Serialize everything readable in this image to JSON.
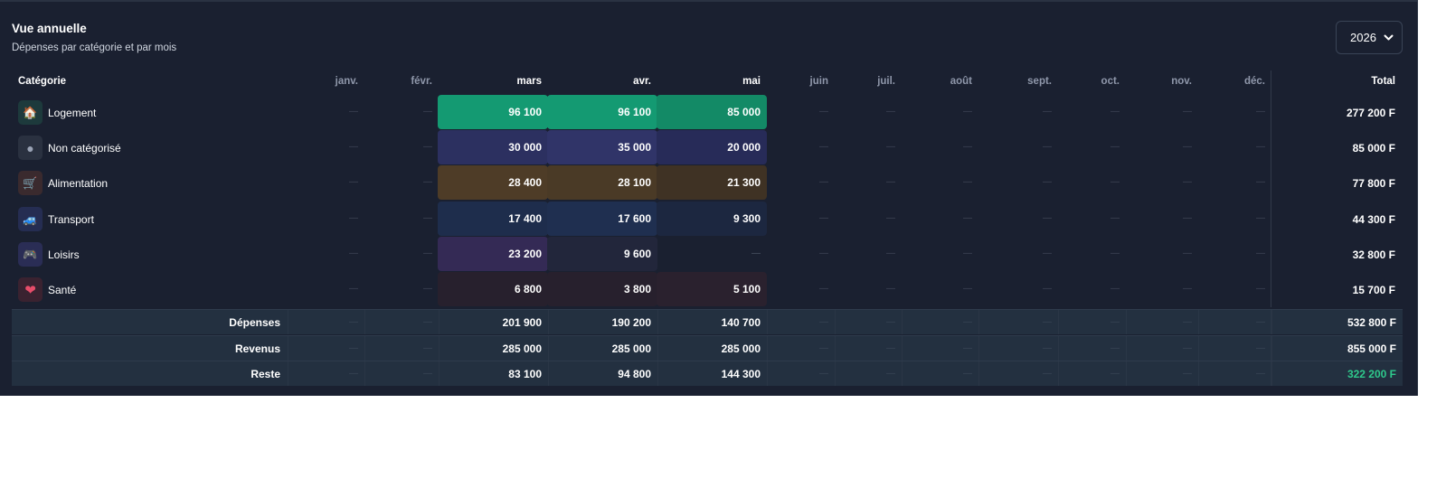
{
  "header": {
    "title": "Vue annuelle",
    "subtitle": "Dépenses par catégorie et par mois",
    "year": "2026"
  },
  "columns": {
    "category": "Catégorie",
    "months": [
      "janv.",
      "févr.",
      "mars",
      "avr.",
      "mai",
      "juin",
      "juil.",
      "août",
      "sept.",
      "oct.",
      "nov.",
      "déc."
    ],
    "total": "Total"
  },
  "empty_value": "—",
  "rows": [
    {
      "label": "Logement",
      "icon": "house-icon",
      "glyph": "🏠",
      "values": [
        "",
        "",
        "96 100",
        "96 100",
        "85 000",
        "",
        "",
        "",
        "",
        "",
        "",
        ""
      ],
      "total": "277 200 F"
    },
    {
      "label": "Non catégorisé",
      "icon": "dot-icon",
      "glyph": "●",
      "values": [
        "",
        "",
        "30 000",
        "35 000",
        "20 000",
        "",
        "",
        "",
        "",
        "",
        "",
        ""
      ],
      "total": "85 000 F"
    },
    {
      "label": "Alimentation",
      "icon": "cart-icon",
      "glyph": "🛒",
      "values": [
        "",
        "",
        "28 400",
        "28 100",
        "21 300",
        "",
        "",
        "",
        "",
        "",
        "",
        ""
      ],
      "total": "77 800 F"
    },
    {
      "label": "Transport",
      "icon": "car-icon",
      "glyph": "🚙",
      "values": [
        "",
        "",
        "17 400",
        "17 600",
        "9 300",
        "",
        "",
        "",
        "",
        "",
        "",
        ""
      ],
      "total": "44 300 F"
    },
    {
      "label": "Loisirs",
      "icon": "gamepad-icon",
      "glyph": "🎮",
      "values": [
        "",
        "",
        "23 200",
        "9 600",
        "",
        "",
        "",
        "",
        "",
        "",
        "",
        ""
      ],
      "total": "32 800 F"
    },
    {
      "label": "Santé",
      "icon": "heart-icon",
      "glyph": "❤",
      "values": [
        "",
        "",
        "6 800",
        "3 800",
        "5 100",
        "",
        "",
        "",
        "",
        "",
        "",
        ""
      ],
      "total": "15 700 F"
    }
  ],
  "footer": [
    {
      "label": "Dépenses",
      "values": [
        "",
        "",
        "201 900",
        "190 200",
        "140 700",
        "",
        "",
        "",
        "",
        "",
        "",
        ""
      ],
      "total": "532 800 F"
    },
    {
      "label": "Revenus",
      "values": [
        "",
        "",
        "285 000",
        "285 000",
        "285 000",
        "",
        "",
        "",
        "",
        "",
        "",
        ""
      ],
      "total": "855 000 F"
    },
    {
      "label": "Reste",
      "values": [
        "",
        "",
        "83 100",
        "94 800",
        "144 300",
        "",
        "",
        "",
        "",
        "",
        "",
        ""
      ],
      "total": "322 200 F"
    }
  ],
  "colors": {
    "reste_total": "#2ec98c",
    "logement": [
      "#149a72",
      "#149a72",
      "#138a66"
    ],
    "non_categorise": [
      "#2c3060",
      "#303468",
      "#272b58"
    ],
    "alimentation": [
      "#4e3c27",
      "#4a3a26",
      "#3f3224"
    ],
    "transport": [
      "#1e2d4c",
      "#1f2f50",
      "#1c2740"
    ],
    "loisirs": [
      "#342a55",
      "#22263b",
      null
    ],
    "sante": [
      "#27202d",
      "#27202d",
      "#2a212e"
    ]
  }
}
